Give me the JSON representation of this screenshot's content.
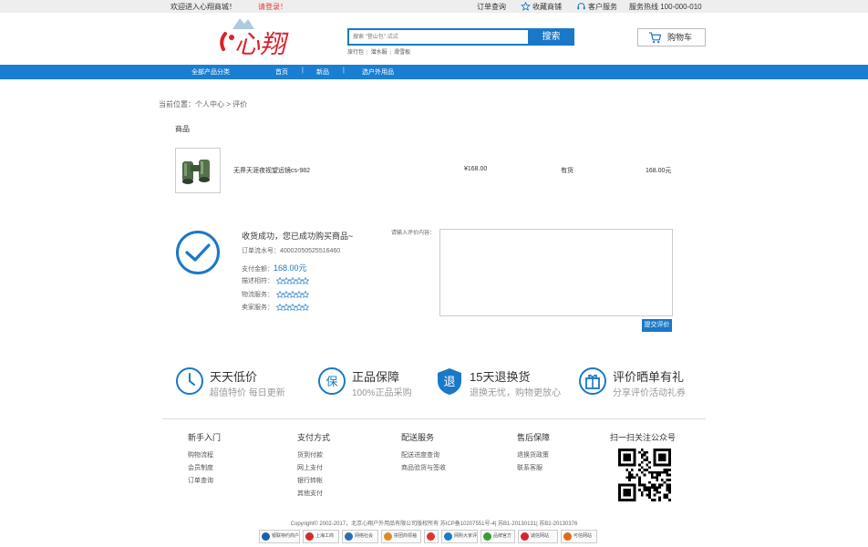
{
  "topbar": {
    "welcome": "欢迎进入心翔商城！",
    "login": "请登录！",
    "orders": "订单查询",
    "favorites": "收藏商铺",
    "service": "客户服务",
    "hotline": "服务热线 100-000-010"
  },
  "header": {
    "logo_text": "心翔",
    "search_placeholder": "搜索 \"登山包\" 试试",
    "search_button": "搜索",
    "hot_words": [
      "旅行包",
      "潜水服",
      "滑雪板"
    ],
    "cart_label": "购物车"
  },
  "nav": {
    "all_categories": "全部产品分类",
    "items": [
      "首页",
      "新品",
      "选户外用品"
    ]
  },
  "breadcrumb": {
    "label": "当前位置：",
    "items": [
      "个人中心",
      "评价"
    ]
  },
  "goods": {
    "heading": "商品",
    "name": "无界天涯夜视望远镜cs-982",
    "price": "¥168.00",
    "stock": "有货",
    "total": "168.00元"
  },
  "success": {
    "title": "收货成功，您已成功购买商品~",
    "order_no": "订单流水号：40002050525516460",
    "pay_label": "支付金额：",
    "pay_amount": "168.00元",
    "ratings": [
      {
        "label": "描述相符：",
        "stars": 0
      },
      {
        "label": "物流服务：",
        "stars": 0
      },
      {
        "label": "卖家服务：",
        "stars": 0
      }
    ]
  },
  "review": {
    "label": "请输入评价内容：",
    "value": "",
    "submit": "提交评价"
  },
  "features": [
    {
      "icon": "clock-icon",
      "title": "天天低价",
      "sub": "超值特价 每日更新"
    },
    {
      "icon": "guarantee-icon",
      "title": "正品保障",
      "sub": "100%正品采购"
    },
    {
      "icon": "return-icon",
      "title": "15天退换货",
      "sub": "退换无忧，购物更放心"
    },
    {
      "icon": "gift-icon",
      "title": "评价晒单有礼",
      "sub": "分享评价活动礼券"
    }
  ],
  "footer": {
    "columns": [
      {
        "title": "新手入门",
        "links": [
          "购物流程",
          "会员制度",
          "订单查询"
        ]
      },
      {
        "title": "支付方式",
        "links": [
          "货到付款",
          "网上支付",
          "银行转帐",
          "其他支付"
        ]
      },
      {
        "title": "配送服务",
        "links": [
          "配送进度查询",
          "商品验货与签收"
        ]
      },
      {
        "title": "售后保障",
        "links": [
          "退换货政策",
          "联系客服"
        ]
      }
    ],
    "qr_title": "扫一扫关注公众号",
    "copyright": "Copyright© 2002-2017，北京心翔户外用品有限公司版权所有 苏ICP备10207551号-4| 苏B1-20130131| 苏B2-20130376",
    "badges": [
      "银联特约商户",
      "上海工商",
      "网络社会",
      "拼团商领袖",
      "",
      "网购大家评",
      "品牌官方",
      "诚信网站",
      "可信网站"
    ]
  },
  "colors": {
    "primary": "#1a78c8",
    "nav": "#1a7fd3",
    "logo_red": "#d9232e"
  }
}
